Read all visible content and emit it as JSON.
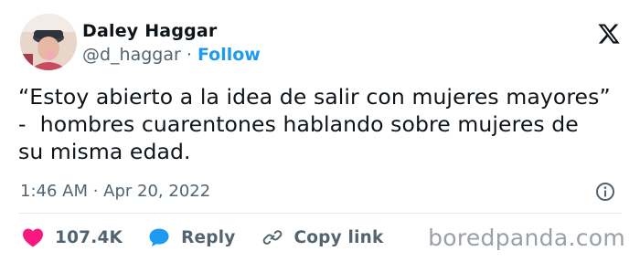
{
  "author": {
    "display_name": "Daley Haggar",
    "handle": "@d_haggar",
    "separator": "·",
    "follow_label": "Follow"
  },
  "tweet": {
    "text": "“Estoy abierto a la idea de salir con mujeres mayores”\n-  hombres cuarentones hablando sobre mujeres de\nsu misma edad.",
    "timestamp": "1:46 AM · Apr 20, 2022"
  },
  "actions": {
    "like_count": "107.4K",
    "reply_label": "Reply",
    "copy_link_label": "Copy link"
  },
  "watermark": "boredpanda.com",
  "colors": {
    "accent": "#1d9bf0",
    "heart": "#f91880",
    "text_primary": "#0f1419",
    "text_secondary": "#536471"
  },
  "icons": {
    "logo": "x-logo-icon",
    "info": "info-icon",
    "like": "heart-icon",
    "reply": "speech-bubble-icon",
    "copy_link": "link-icon"
  }
}
